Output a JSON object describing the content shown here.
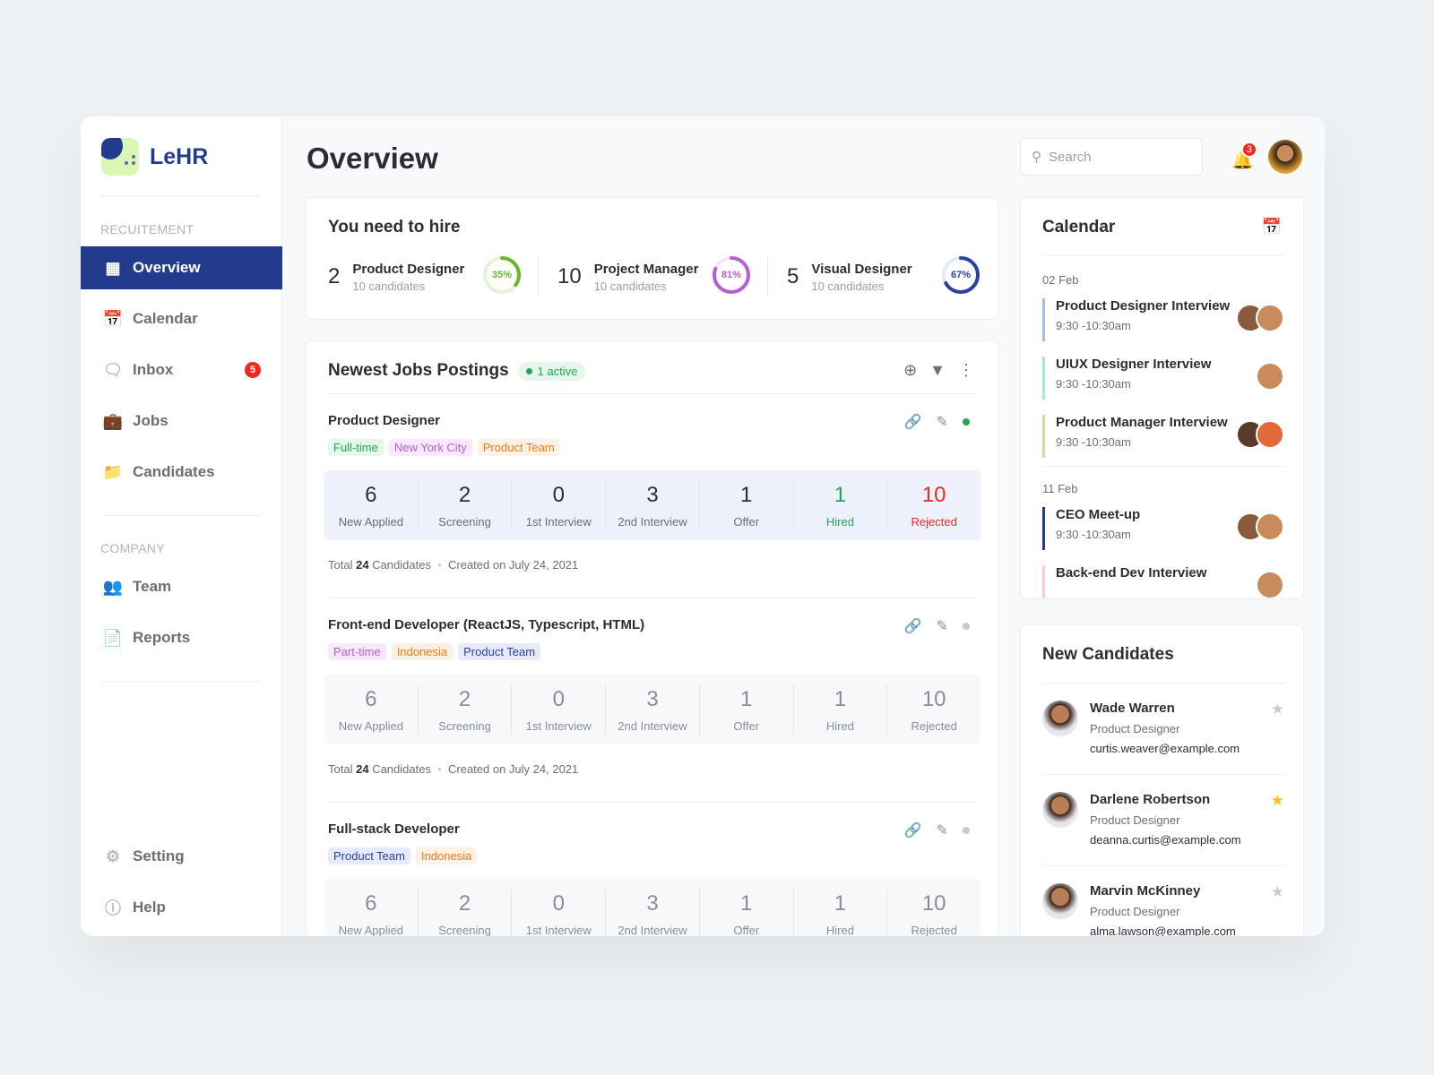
{
  "brand": {
    "name": "LeHR"
  },
  "sidebar": {
    "section1": "RECUITEMENT",
    "section2": "COMPANY",
    "items": [
      {
        "label": "Overview",
        "icon": "grid-icon",
        "active": true
      },
      {
        "label": "Calendar",
        "icon": "calendar-icon"
      },
      {
        "label": "Inbox",
        "icon": "chat-icon",
        "badge": "5"
      },
      {
        "label": "Jobs",
        "icon": "briefcase-icon"
      },
      {
        "label": "Candidates",
        "icon": "folder-user-icon"
      }
    ],
    "company": [
      {
        "label": "Team",
        "icon": "team-icon"
      },
      {
        "label": "Reports",
        "icon": "document-icon"
      }
    ],
    "bottom": [
      {
        "label": "Setting",
        "icon": "gear-icon"
      },
      {
        "label": "Help",
        "icon": "help-icon"
      }
    ]
  },
  "header": {
    "title": "Overview",
    "search_placeholder": "Search",
    "notifications": "3"
  },
  "hire": {
    "title": "You need to hire",
    "items": [
      {
        "count": "2",
        "role": "Product Designer",
        "sub": "10 candidates",
        "percent": 35,
        "label": "35%",
        "color": "#6bb52a",
        "track": "#e5f3d7"
      },
      {
        "count": "10",
        "role": "Project Manager",
        "sub": "10 candidates",
        "percent": 81,
        "label": "81%",
        "color": "#b55fd6",
        "track": "#f3e5f9"
      },
      {
        "count": "5",
        "role": "Visual Designer",
        "sub": "10 candidates",
        "percent": 67,
        "label": "67%",
        "color": "#2a3fa8",
        "track": "#e6e9f6"
      }
    ]
  },
  "jobs": {
    "title": "Newest Jobs Postings",
    "active": "1 active",
    "stat_labels": [
      "New Applied",
      "Screening",
      "1st Interview",
      "2nd Interview",
      "Offer",
      "Hired",
      "Rejected"
    ],
    "list": [
      {
        "title": "Product Designer",
        "active": true,
        "tags": [
          {
            "t": "Full-time",
            "c": "green"
          },
          {
            "t": "New York City",
            "c": "purple"
          },
          {
            "t": "Product Team",
            "c": "orange"
          }
        ],
        "stats": [
          "6",
          "2",
          "0",
          "3",
          "1",
          "1",
          "10"
        ],
        "total_prefix": "Total",
        "total": "24",
        "total_suffix": "Candidates",
        "created": "Created on July 24, 2021"
      },
      {
        "title": "Front-end Developer (ReactJS, Typescript, HTML)",
        "active": false,
        "tags": [
          {
            "t": "Part-time",
            "c": "purple"
          },
          {
            "t": "Indonesia",
            "c": "orange"
          },
          {
            "t": "Product Team",
            "c": "blue"
          }
        ],
        "stats": [
          "6",
          "2",
          "0",
          "3",
          "1",
          "1",
          "10"
        ],
        "total_prefix": "Total",
        "total": "24",
        "total_suffix": "Candidates",
        "created": "Created on July 24, 2021"
      },
      {
        "title": "Full-stack Developer",
        "active": false,
        "tags": [
          {
            "t": "Product Team",
            "c": "blue"
          },
          {
            "t": "Indonesia",
            "c": "orange"
          }
        ],
        "stats": [
          "6",
          "2",
          "0",
          "3",
          "1",
          "1",
          "10"
        ]
      }
    ]
  },
  "calendar": {
    "title": "Calendar",
    "groups": [
      {
        "date": "02 Feb",
        "events": [
          {
            "title": "Product Designer Interview",
            "time": "9:30 -10:30am",
            "color": "#a9b8f0",
            "avatars": 2
          },
          {
            "title": "UIUX Designer Interview",
            "time": "9:30 -10:30am",
            "color": "#a6e7e3",
            "avatars": 1
          },
          {
            "title": "Product Manager Interview",
            "time": "9:30 -10:30am",
            "color": "#c4e6a0",
            "avatars": 2
          }
        ]
      },
      {
        "date": "11 Feb",
        "events": [
          {
            "title": "CEO Meet-up",
            "time": "9:30 -10:30am",
            "color": "#223b8c",
            "avatars": 2
          },
          {
            "title": "Back-end Dev Interview",
            "time": "",
            "color": "#f6cde3",
            "avatars": 1
          }
        ]
      }
    ]
  },
  "candidates": {
    "title": "New Candidates",
    "list": [
      {
        "name": "Wade Warren",
        "role": "Product Designer",
        "email": "curtis.weaver@example.com",
        "starred": false
      },
      {
        "name": "Darlene Robertson",
        "role": "Product Designer",
        "email": "deanna.curtis@example.com",
        "starred": true
      },
      {
        "name": "Marvin McKinney",
        "role": "Product Designer",
        "email": "alma.lawson@example.com",
        "starred": false
      }
    ]
  },
  "colors": {
    "brand": "#223b8c",
    "green": "#22a753",
    "red": "#f0291e"
  }
}
